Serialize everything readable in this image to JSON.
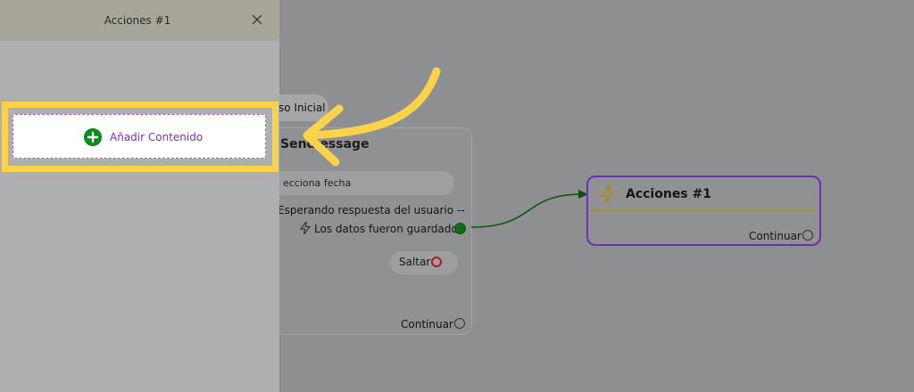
{
  "side_panel": {
    "title": "Acciones #1",
    "close_icon": "close-icon",
    "add_content_label": "Añadir Contenido",
    "add_content_icon": "plus-circle-icon",
    "highlight_color": "#fbd34a"
  },
  "canvas": {
    "start_node": {
      "label": "so Inicial"
    },
    "send_message_node": {
      "title": "Send essage",
      "date_input_placeholder": "ecciona fecha",
      "waiting_text": "Esperando respuesta del usuario --",
      "saved_label": "Los datos fueron guardados",
      "saved_icon": "lightning-icon",
      "skip_label": "Saltar",
      "continue_label": "Continuar"
    },
    "actions_node": {
      "title": "Acciones #1",
      "icon": "lightning-icon",
      "continue_label": "Continuar",
      "border_color": "#6c2fb8"
    }
  },
  "colors": {
    "accent_purple": "#7a2bd0",
    "success_green": "#0d8c1e",
    "annotation_yellow": "#fbd34a",
    "skip_red": "#b21b1b"
  }
}
